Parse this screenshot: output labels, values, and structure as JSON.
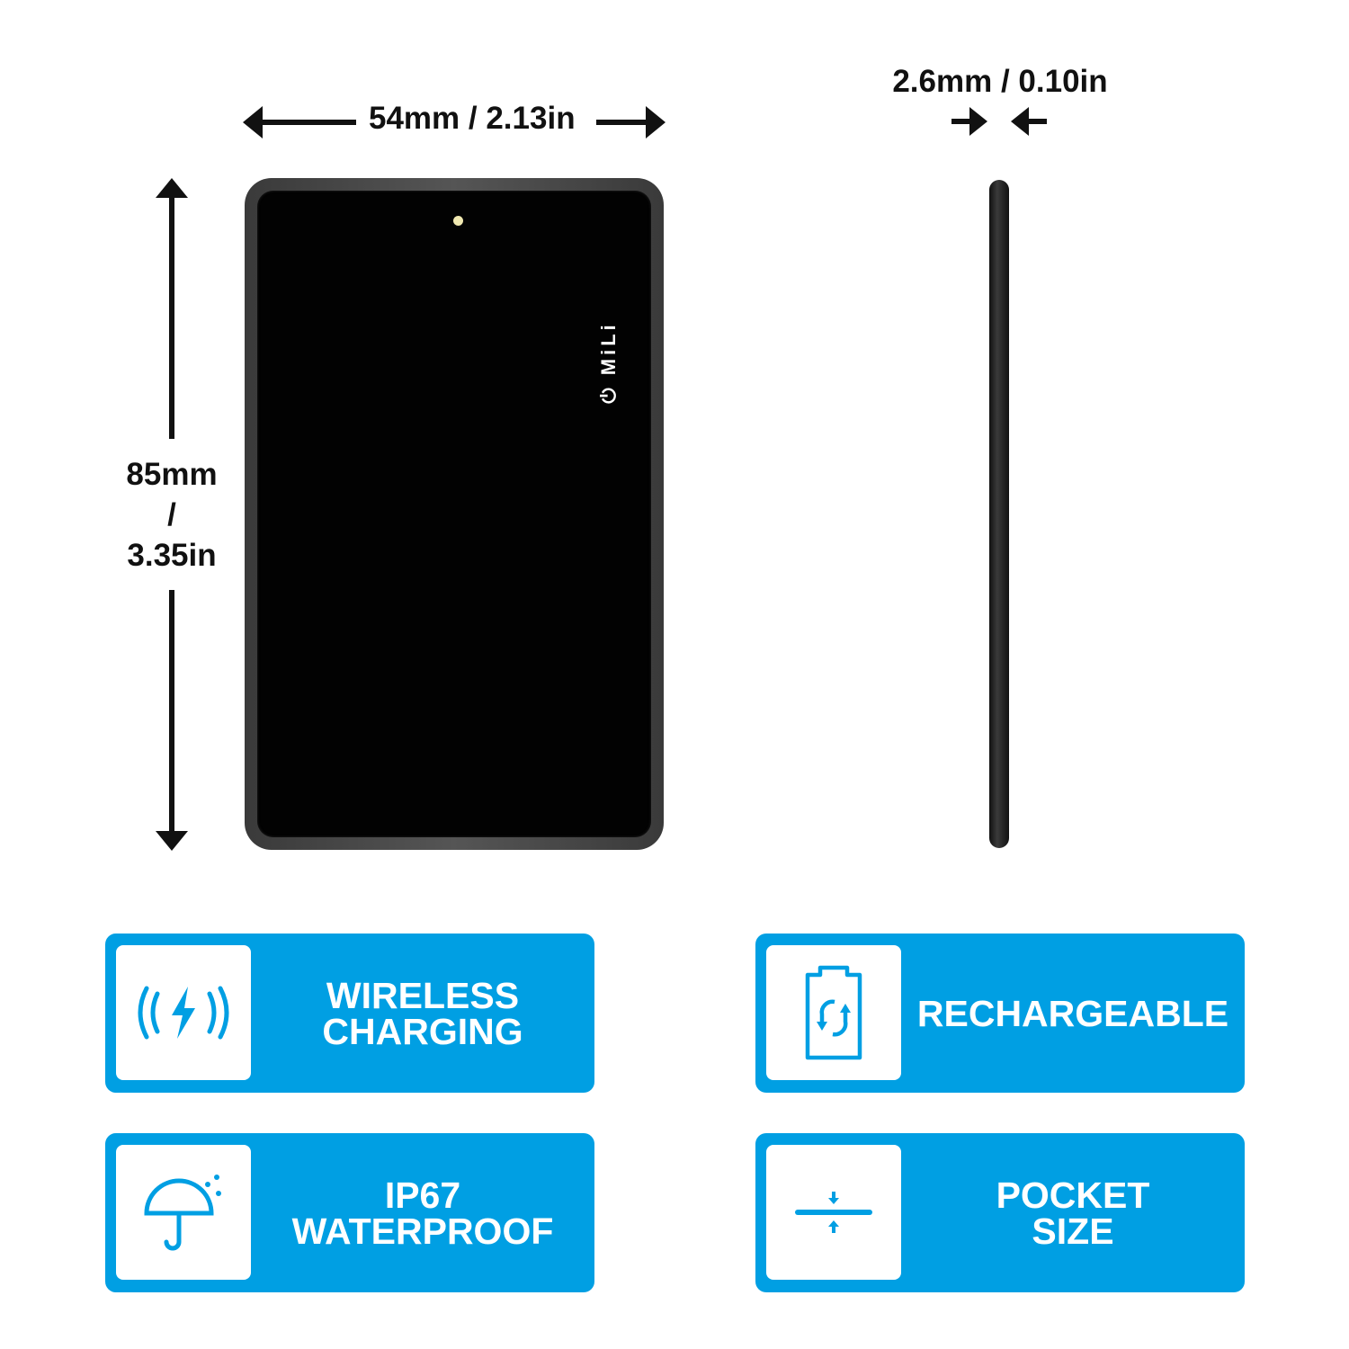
{
  "dimensions": {
    "width_label": "54mm / 2.13in",
    "height_label_mm": "85mm",
    "height_label_sep": "/",
    "height_label_in": "3.35in",
    "thickness_label": "2.6mm / 0.10in"
  },
  "product": {
    "logo_text": "MiLi",
    "logo_icon": "power-icon"
  },
  "colors": {
    "accent": "#009fe3",
    "card": "#020202",
    "text": "#111111"
  },
  "features": [
    {
      "icon": "wireless-charging-icon",
      "label": "WIRELESS\nCHARGING"
    },
    {
      "icon": "battery-recharge-icon",
      "label": "RECHARGEABLE"
    },
    {
      "icon": "umbrella-rain-icon",
      "label": "IP67\nWATERPROOF"
    },
    {
      "icon": "compress-thin-icon",
      "label": "POCKET\nSIZE"
    }
  ]
}
